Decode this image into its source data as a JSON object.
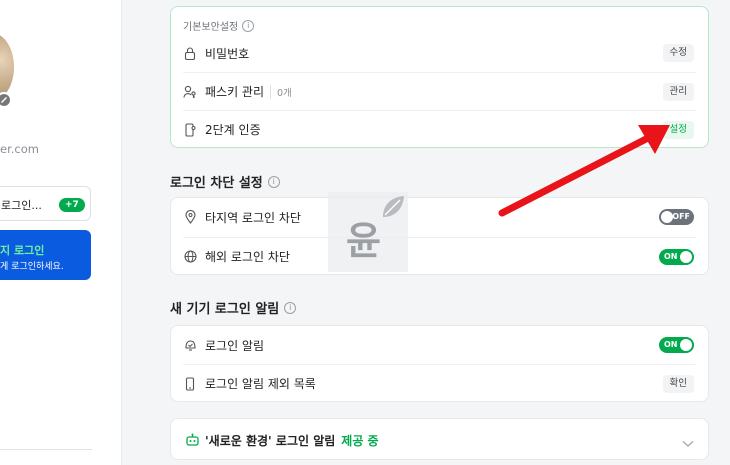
{
  "sidebar": {
    "email_partial": "er.com",
    "login_card_label": "로그인...",
    "login_card_badge": "+7",
    "blue_card_title": "지 로그인",
    "blue_card_subtitle": "게 로그인하세요."
  },
  "basic_security": {
    "label": "기본보안설정",
    "rows": [
      {
        "icon": "lock-icon",
        "label": "비밀번호",
        "action": "수정"
      },
      {
        "icon": "passkey-icon",
        "label": "패스키 관리",
        "sub": "0개",
        "action": "관리"
      },
      {
        "icon": "phone-key-icon",
        "label": "2단계 인증",
        "action": "설정"
      }
    ]
  },
  "login_block": {
    "title": "로그인 차단 설정",
    "rows": [
      {
        "icon": "location-pin-icon",
        "label": "타지역 로그인 차단",
        "toggle": "OFF"
      },
      {
        "icon": "globe-icon",
        "label": "해외 로그인 차단",
        "toggle": "ON"
      }
    ]
  },
  "new_device": {
    "title": "새 기기 로그인 알림",
    "rows": [
      {
        "icon": "bell-check-icon",
        "label": "로그인 알림",
        "toggle": "ON"
      },
      {
        "icon": "smartphone-icon",
        "label": "로그인 알림 제외 목록",
        "action": "확인"
      }
    ]
  },
  "new_env": {
    "label": "'새로운 환경' 로그인 알림",
    "status": "제공 중"
  },
  "watermark": {
    "text": "윤"
  },
  "colors": {
    "accent_green": "#03a94d",
    "blue_card": "#0b5be0",
    "arrow_red": "#e8141a"
  }
}
